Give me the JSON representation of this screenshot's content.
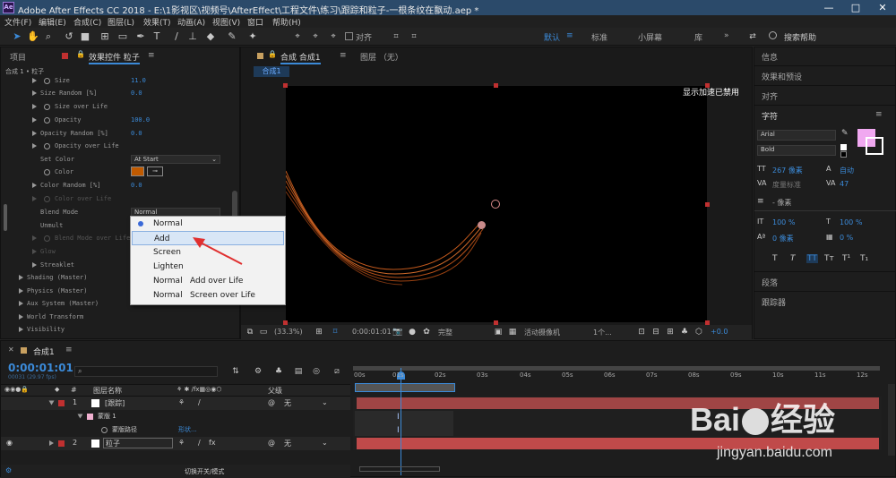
{
  "window": {
    "title": "Adobe After Effects CC 2018 - E:\\1影视区\\视频号\\AfterEffect\\工程文件\\练习\\跟踪和粒子-一根条纹在飘动.aep *",
    "min": "—",
    "max": "□",
    "close": "✕",
    "logo": "Ae"
  },
  "menu": [
    "文件(F)",
    "编辑(E)",
    "合成(C)",
    "图层(L)",
    "效果(T)",
    "动画(A)",
    "视图(V)",
    "窗口",
    "帮助(H)"
  ],
  "toolbar": {
    "align_label": "对齐",
    "workspaces": [
      "默认",
      "标准",
      "小屏幕",
      "库"
    ],
    "active_ws": "默认",
    "more": "»",
    "search_placeholder": "搜索帮助"
  },
  "left_panel": {
    "tab_project": "项目",
    "tab_effects": "效果控件 粒子",
    "breadcrumb": "合成 1 • 粒子",
    "rows": [
      {
        "label": "Size",
        "value": "11.0"
      },
      {
        "label": "Size Random [%]",
        "value": "0.0"
      },
      {
        "label": "Size over Life",
        "value": ""
      },
      {
        "label": "Opacity",
        "value": "100.0"
      },
      {
        "label": "Opacity Random [%]",
        "value": "0.0"
      },
      {
        "label": "Opacity over Life",
        "value": ""
      },
      {
        "label": "Set Color",
        "value": "At Start"
      },
      {
        "label": "Color",
        "value": ""
      },
      {
        "label": "Color Random [%]",
        "value": "0.0"
      },
      {
        "label": "Color over Life",
        "value": ""
      },
      {
        "label": "Blend Mode",
        "value": "Normal"
      },
      {
        "label": "Unmult",
        "value": ""
      },
      {
        "label": "Blend Mode over Life",
        "value": ""
      },
      {
        "label": "Glow",
        "value": ""
      },
      {
        "label": "Streaklet",
        "value": ""
      },
      {
        "label": "Shading (Master)",
        "value": ""
      },
      {
        "label": "Physics (Master)",
        "value": ""
      },
      {
        "label": "Aux System (Master)",
        "value": ""
      },
      {
        "label": "World Transform",
        "value": ""
      },
      {
        "label": "Visibility",
        "value": ""
      }
    ],
    "color_swatch": "#c05a00"
  },
  "popup": {
    "items": [
      {
        "label": "Normal",
        "secondary": "",
        "checked": true
      },
      {
        "label": "Add",
        "secondary": "",
        "checked": false
      },
      {
        "label": "Screen",
        "secondary": "",
        "checked": false
      },
      {
        "label": "Lighten",
        "secondary": "",
        "checked": false
      },
      {
        "label": "Normal",
        "secondary": "Add over Life",
        "checked": false
      },
      {
        "label": "Normal",
        "secondary": "Screen over Life",
        "checked": false
      }
    ]
  },
  "comp_panel": {
    "tab_comp": "合成 合成1",
    "tab_layer": "图层 （无）",
    "comp_tab": "合成1",
    "gpu_notice": "显示加速已禁用",
    "footer": {
      "zoom": "(33.3%)",
      "time": "0:00:01:01",
      "quality": "完整",
      "camera": "活动摄像机",
      "views": "1个...",
      "exposure": "+0.0"
    }
  },
  "right_panel": {
    "items": [
      "信息",
      "效果和预设",
      "对齐",
      "字符",
      "段落",
      "跟踪器"
    ],
    "font": "Arial",
    "style": "Bold",
    "size": "267 像素",
    "leading": "自动",
    "kerning": "度量标准",
    "tracking": "47",
    "stroke_unit": "- 像素",
    "vscale": "100 %",
    "hscale": "100 %",
    "baseline": "0 像素",
    "tsume": "0 %",
    "fill_color": "#f0a8f0",
    "type_buttons": [
      "T",
      "T",
      "TT",
      "Tт",
      "T¹",
      "T₁"
    ]
  },
  "timeline": {
    "tab": "合成1",
    "timecode": "0:00:01:01",
    "frame_info": "00031 (29.97 fps)",
    "header": {
      "layer_name": "图层名称",
      "parent": "父级",
      "num": "#"
    },
    "ticks": [
      "00s",
      "01s",
      "02s",
      "03s",
      "04s",
      "05s",
      "06s",
      "07s",
      "08s",
      "09s",
      "10s",
      "11s",
      "12s"
    ],
    "layers": [
      {
        "num": "1",
        "name": "[跟踪]",
        "parent": "无",
        "color": "#c03030",
        "bar_color": "#b04040"
      },
      {
        "num": "2",
        "name": "粒子",
        "parent": "无",
        "color": "#c03030",
        "bar_color": "#c04a4a"
      }
    ],
    "mask_label": "蒙版 1",
    "mask_path": "蒙版路径",
    "mask_path_value": "形状...",
    "toggle_label": "切换开关/模式"
  },
  "watermark": {
    "brand": "Bai",
    "brand2": "经验",
    "url": "jingyan.baidu.com"
  }
}
